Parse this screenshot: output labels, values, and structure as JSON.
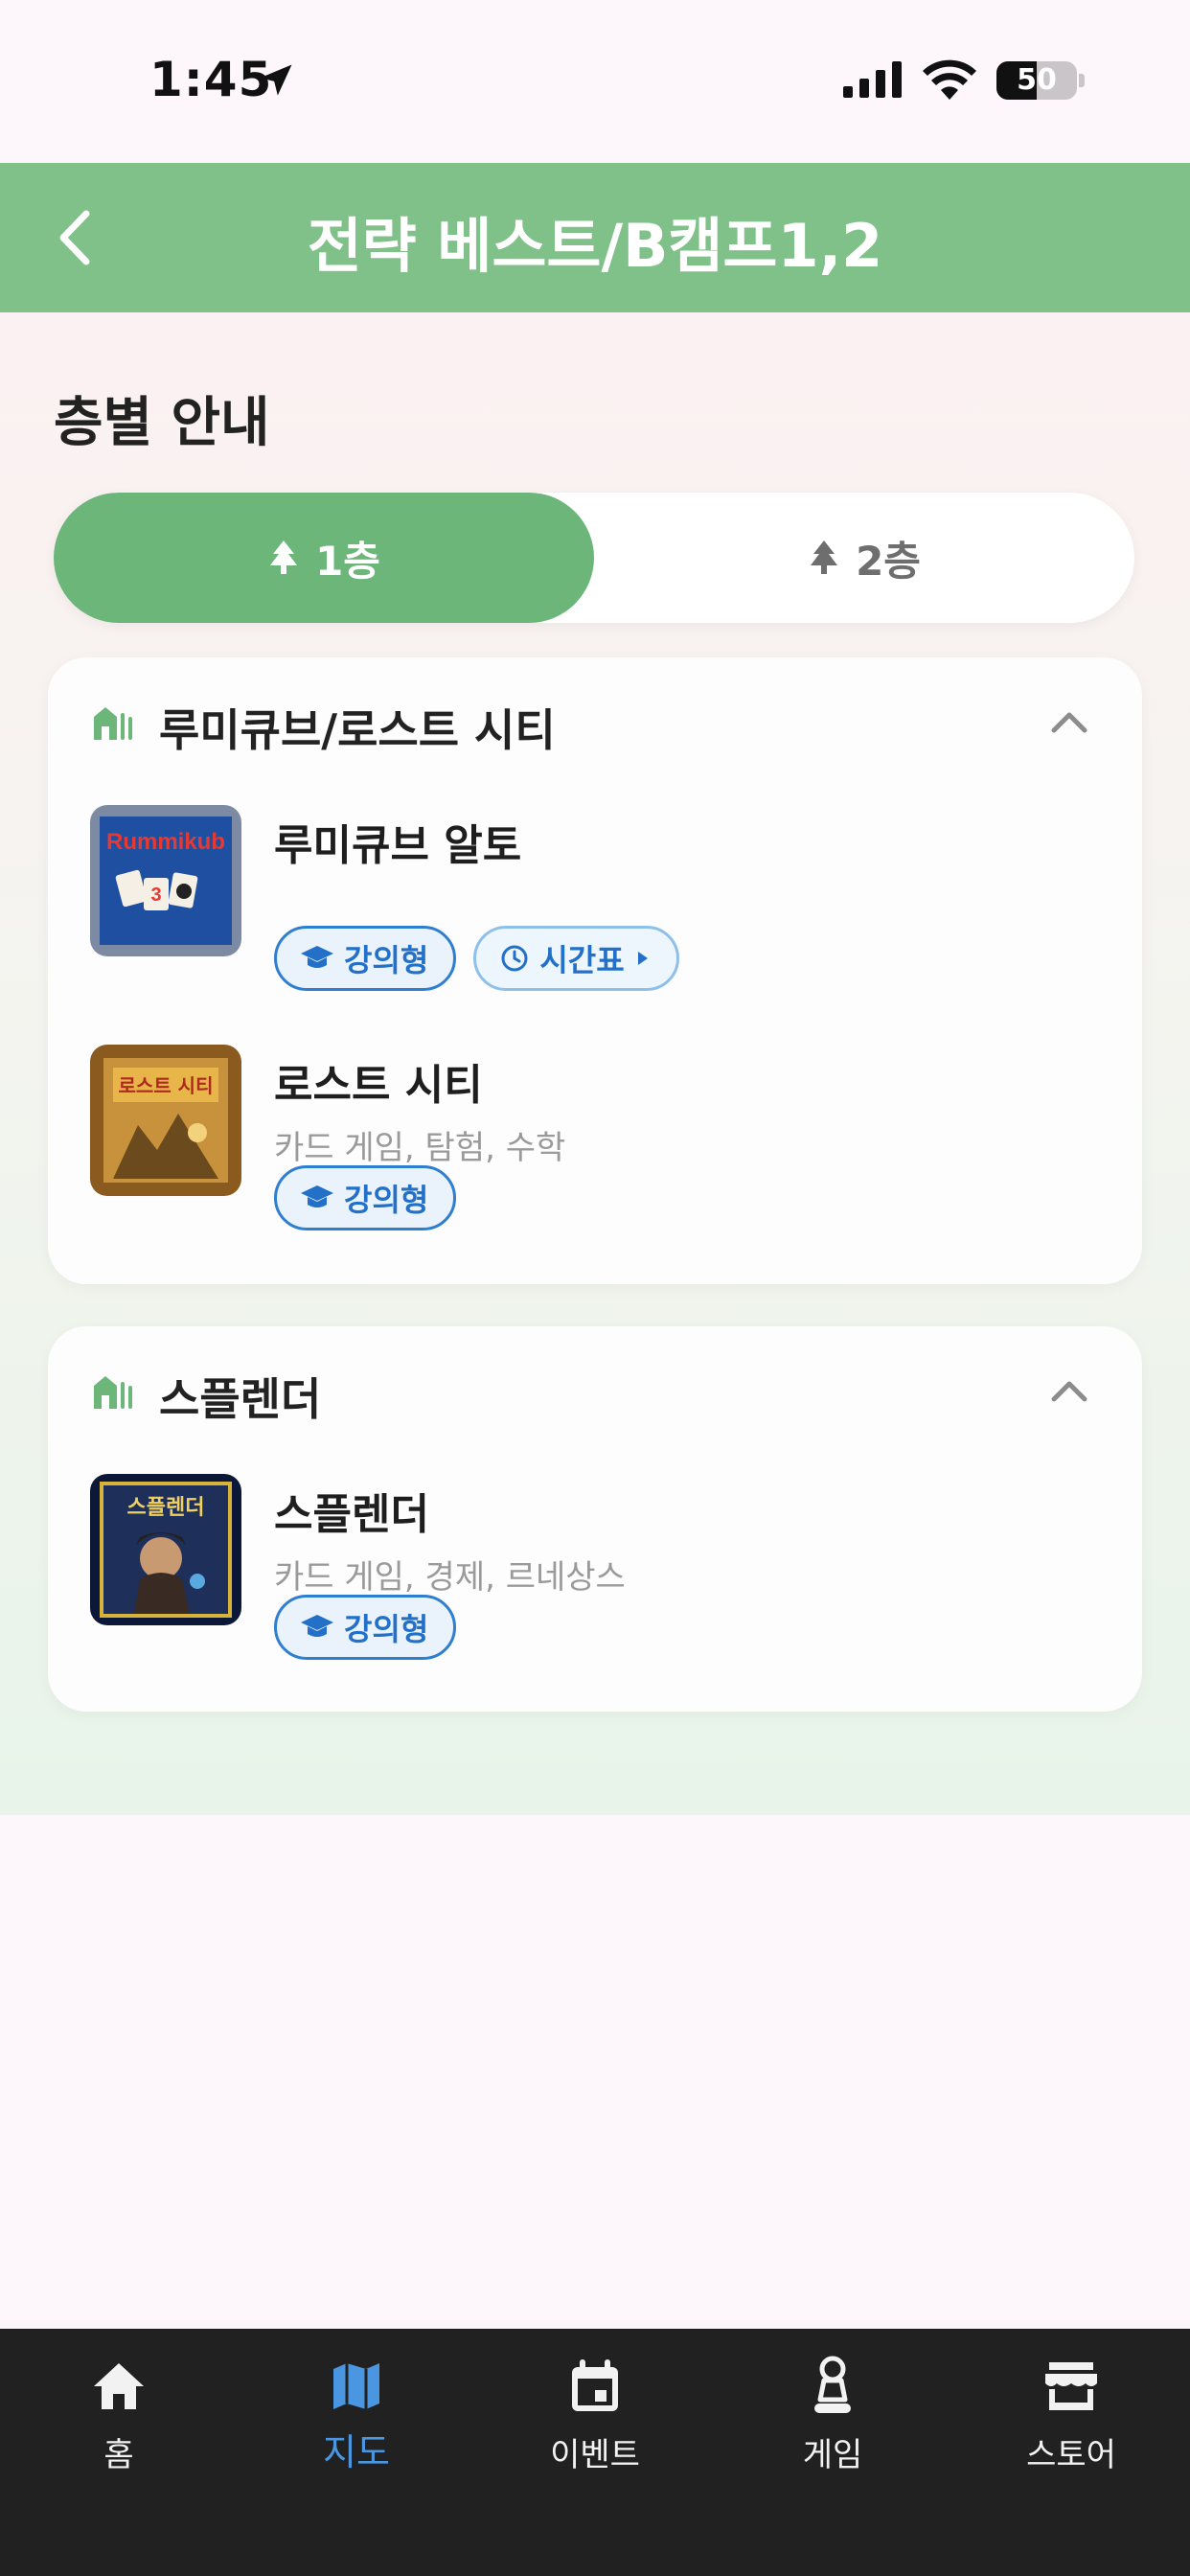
{
  "status_bar": {
    "time": "1:45",
    "battery": "50"
  },
  "header": {
    "title": "전략 베스트/B캠프1,2"
  },
  "section_title": "층별 안내",
  "floor_tabs": [
    {
      "label": "1층",
      "active": true
    },
    {
      "label": "2층",
      "active": false
    }
  ],
  "cards": [
    {
      "title": "루미큐브/로스트 시티",
      "games": [
        {
          "name": "루미큐브 알토",
          "tags": "",
          "chips": [
            "강의형",
            "시간표"
          ]
        },
        {
          "name": "로스트 시티",
          "tags": "카드 게임, 탐험, 수학",
          "chips": [
            "강의형"
          ]
        }
      ]
    },
    {
      "title": "스플렌더",
      "games": [
        {
          "name": "스플렌더",
          "tags": "카드 게임, 경제, 르네상스",
          "chips": [
            "강의형"
          ]
        }
      ]
    }
  ],
  "thumb_text": {
    "rummikub": "Rummikub",
    "lost_city": "로스트 시티",
    "splendor": "스플렌더"
  },
  "nav": [
    {
      "label": "홈",
      "icon": "home-icon",
      "active": false
    },
    {
      "label": "지도",
      "icon": "map-icon",
      "active": true
    },
    {
      "label": "이벤트",
      "icon": "calendar-icon",
      "active": false
    },
    {
      "label": "게임",
      "icon": "pawn-icon",
      "active": false
    },
    {
      "label": "스토어",
      "icon": "store-icon",
      "active": false
    }
  ],
  "colors": {
    "header": "#80c089",
    "tab_active": "#6db679",
    "chip": "#2f7fd1",
    "nav_active": "#4a96e0",
    "nav_bg": "#212121"
  }
}
